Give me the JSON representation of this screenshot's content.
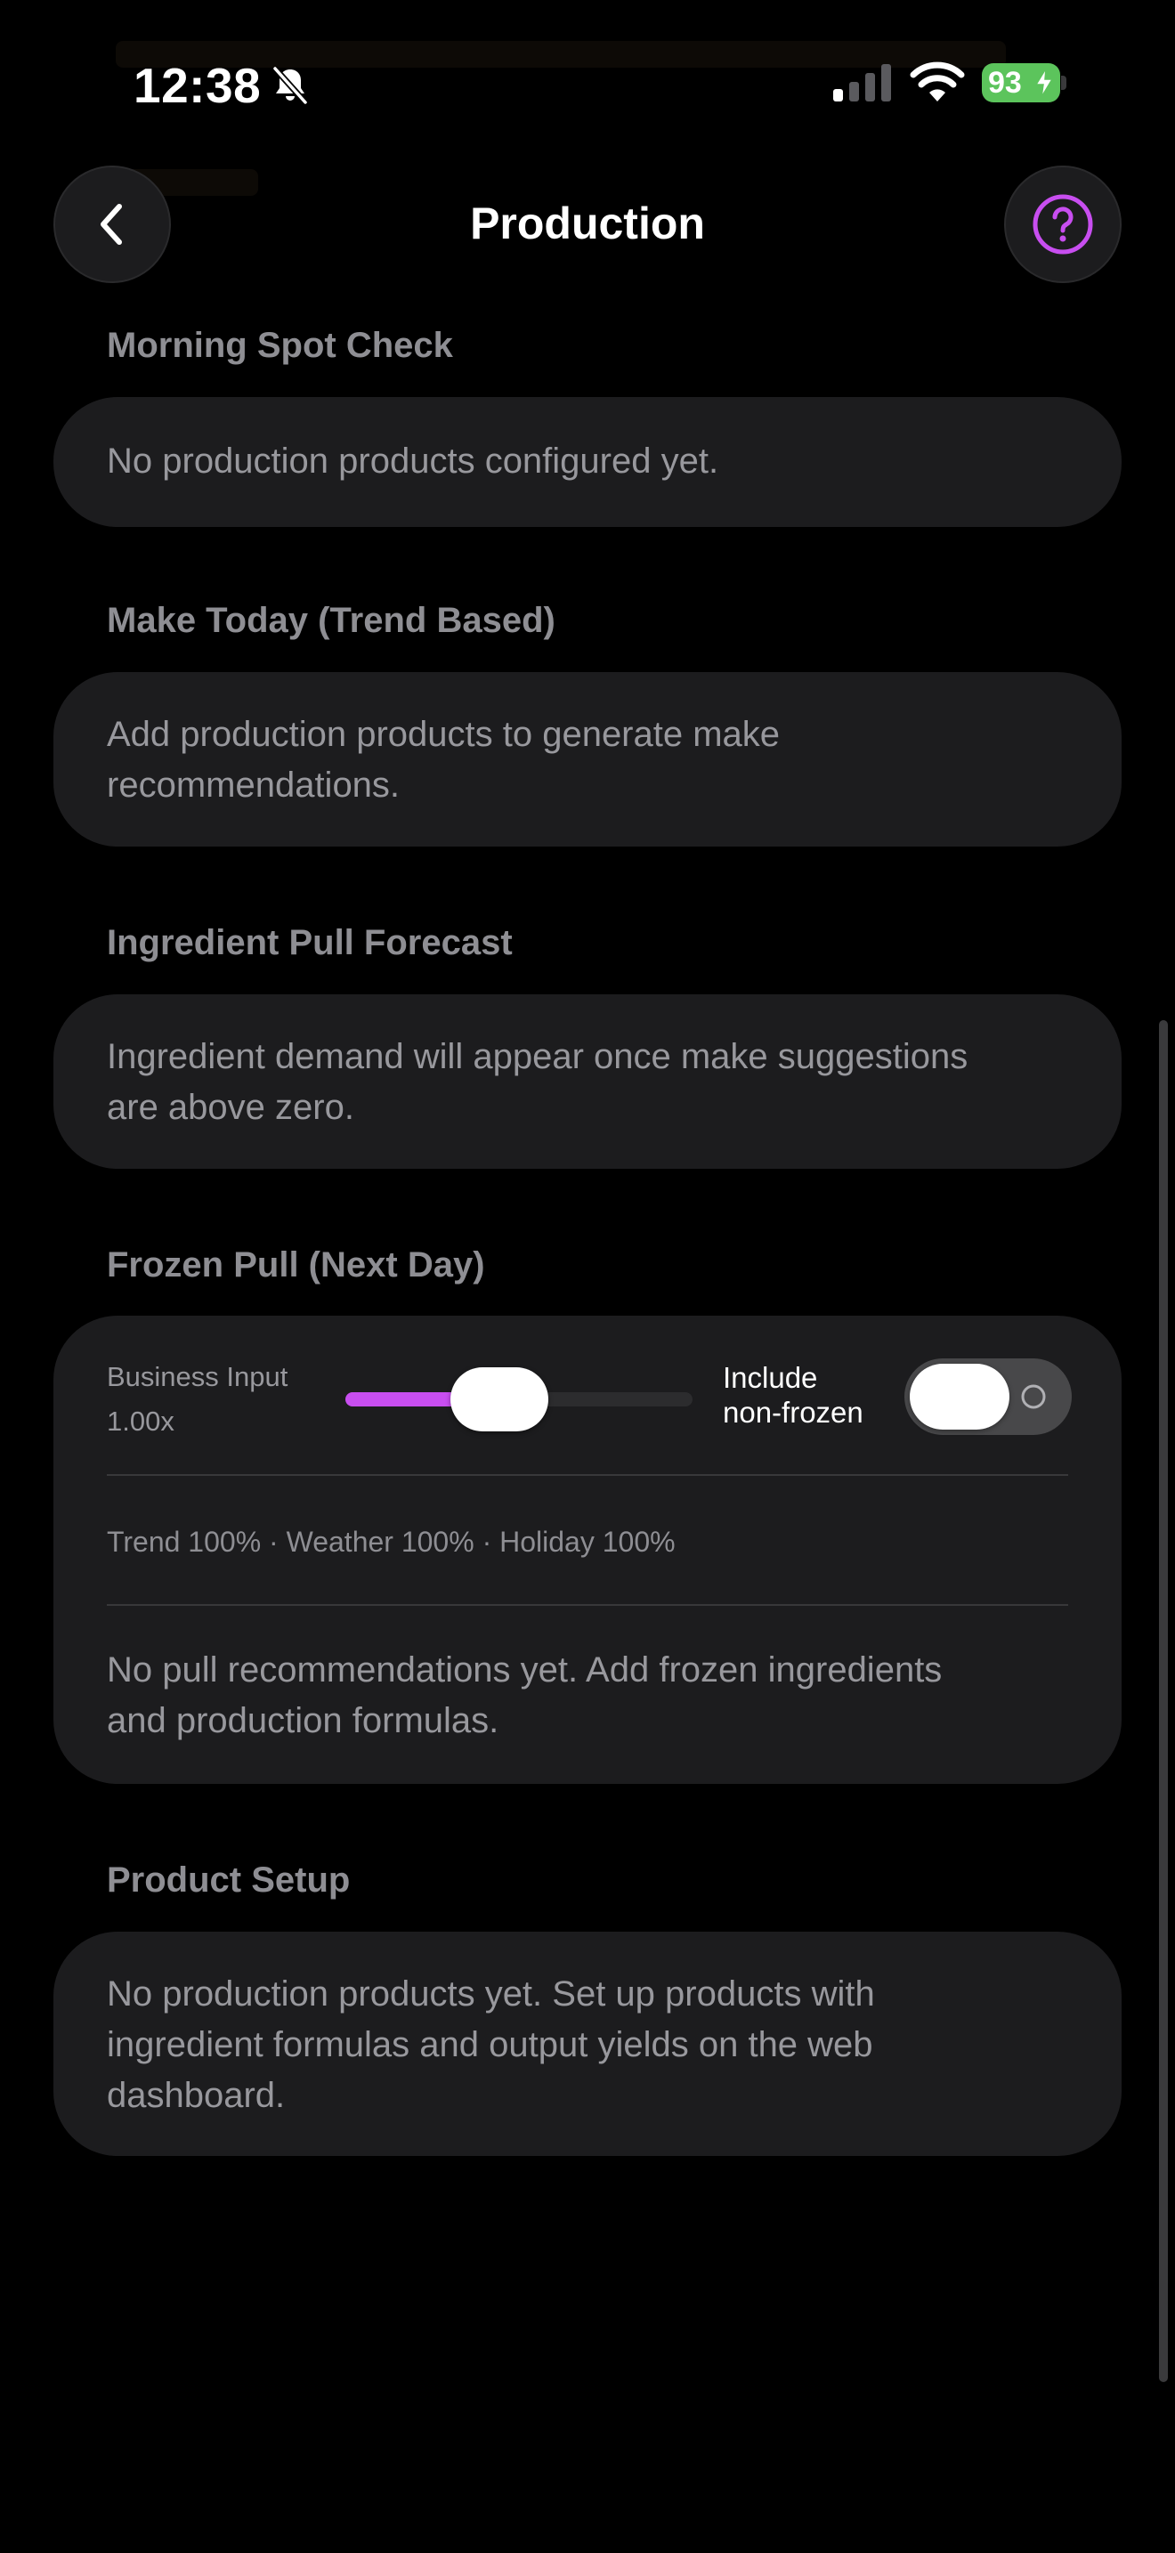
{
  "status_bar": {
    "time": "12:38",
    "battery": "93",
    "icons": [
      "bell-slash-icon",
      "cellular-signal-icon",
      "wifi-icon",
      "battery-charging-icon"
    ],
    "battery_color": "#5cc45c"
  },
  "header": {
    "title": "Production",
    "back_icon": "chevron-left-icon",
    "help_icon": "question-circle-icon"
  },
  "theme": {
    "accent": "#c84ef0",
    "card_bg": "#1c1c1e",
    "page_bg": "#000000"
  },
  "sections": {
    "morning": {
      "label": "Morning Spot Check",
      "text": "No production products configured yet."
    },
    "make_today": {
      "label": "Make Today (Trend Based)",
      "text_lines": [
        "Add production products to generate make",
        "recommendations."
      ]
    },
    "ingredient_pull": {
      "label": "Ingredient Pull Forecast",
      "text_lines": [
        "Ingredient demand will appear once make suggestions",
        "are above zero."
      ]
    },
    "frozen_pull": {
      "label": "Frozen Pull (Next Day)",
      "business_input_label": "Business Input",
      "business_input_value": "1.00x",
      "slider_fraction": 0.42,
      "include_lines": [
        "Include",
        "non-frozen"
      ],
      "include_non_frozen_on": false,
      "factors": "Trend 100% · Weather 100% · Holiday 100%",
      "empty_lines": [
        "No pull recommendations yet. Add frozen ingredients",
        "and production formulas."
      ]
    },
    "product_setup": {
      "label": "Product Setup",
      "text_lines": [
        "No production products yet. Set up products with",
        "ingredient formulas and output yields on the web",
        "dashboard."
      ]
    }
  }
}
